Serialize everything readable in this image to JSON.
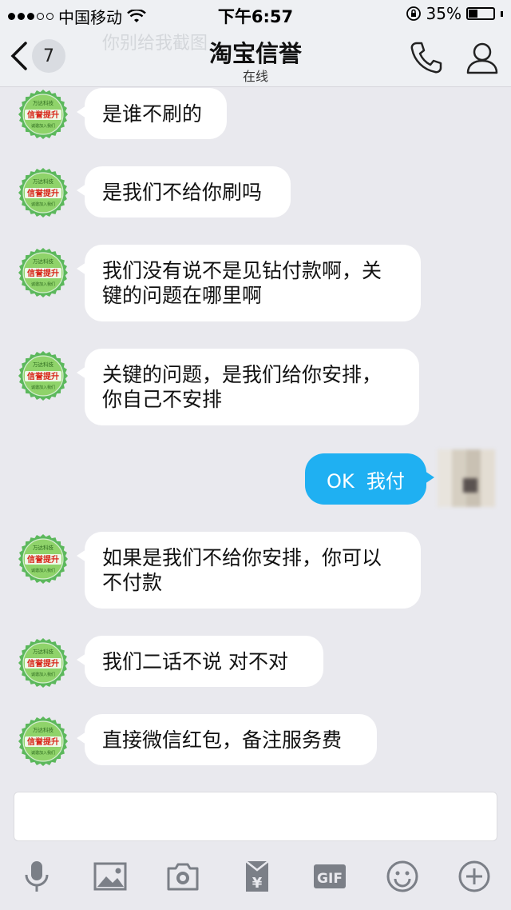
{
  "status": {
    "carrier": "中国移动",
    "time": "下午6:57",
    "battery": "35%",
    "battery_level": 0.35
  },
  "header": {
    "back_count": "7",
    "ghost_text": "你别给我截图",
    "title": "淘宝信誉",
    "subtitle": "在线"
  },
  "avatar_badge": {
    "top": "万达科技",
    "main": "信誉提升",
    "bottom": "诚邀加入我们",
    "color": "#5cb85c"
  },
  "messages": [
    {
      "dir": "in",
      "text_lines": [
        "是谁不刷的"
      ]
    },
    {
      "dir": "in",
      "text_lines": [
        "是我们不给你刷吗"
      ]
    },
    {
      "dir": "in",
      "text_lines": [
        "我们没有说不是见钻付款啊，关",
        "键的问题在哪里啊"
      ]
    },
    {
      "dir": "in",
      "text_lines": [
        "关键的问题，是我们给你安排，",
        "你自己不安排"
      ]
    },
    {
      "dir": "out",
      "text_lines": [
        "OK  我付"
      ]
    },
    {
      "dir": "in",
      "text_lines": [
        "如果是我们不给你安排，你可以",
        "不付款"
      ]
    },
    {
      "dir": "in",
      "text_lines": [
        "我们二话不说  对不对"
      ]
    },
    {
      "dir": "in",
      "text_lines": [
        "直接微信红包，备注服务费"
      ]
    }
  ],
  "input": {
    "placeholder": ""
  },
  "toolbar": {
    "items": [
      "mic-icon",
      "image-icon",
      "camera-icon",
      "red-packet-icon",
      "gif-icon",
      "emoji-icon",
      "plus-icon"
    ],
    "gif_label": "GIF",
    "red_packet_label": "¥"
  },
  "colors": {
    "accent": "#1fb0f2",
    "background": "#e9e9ee"
  }
}
